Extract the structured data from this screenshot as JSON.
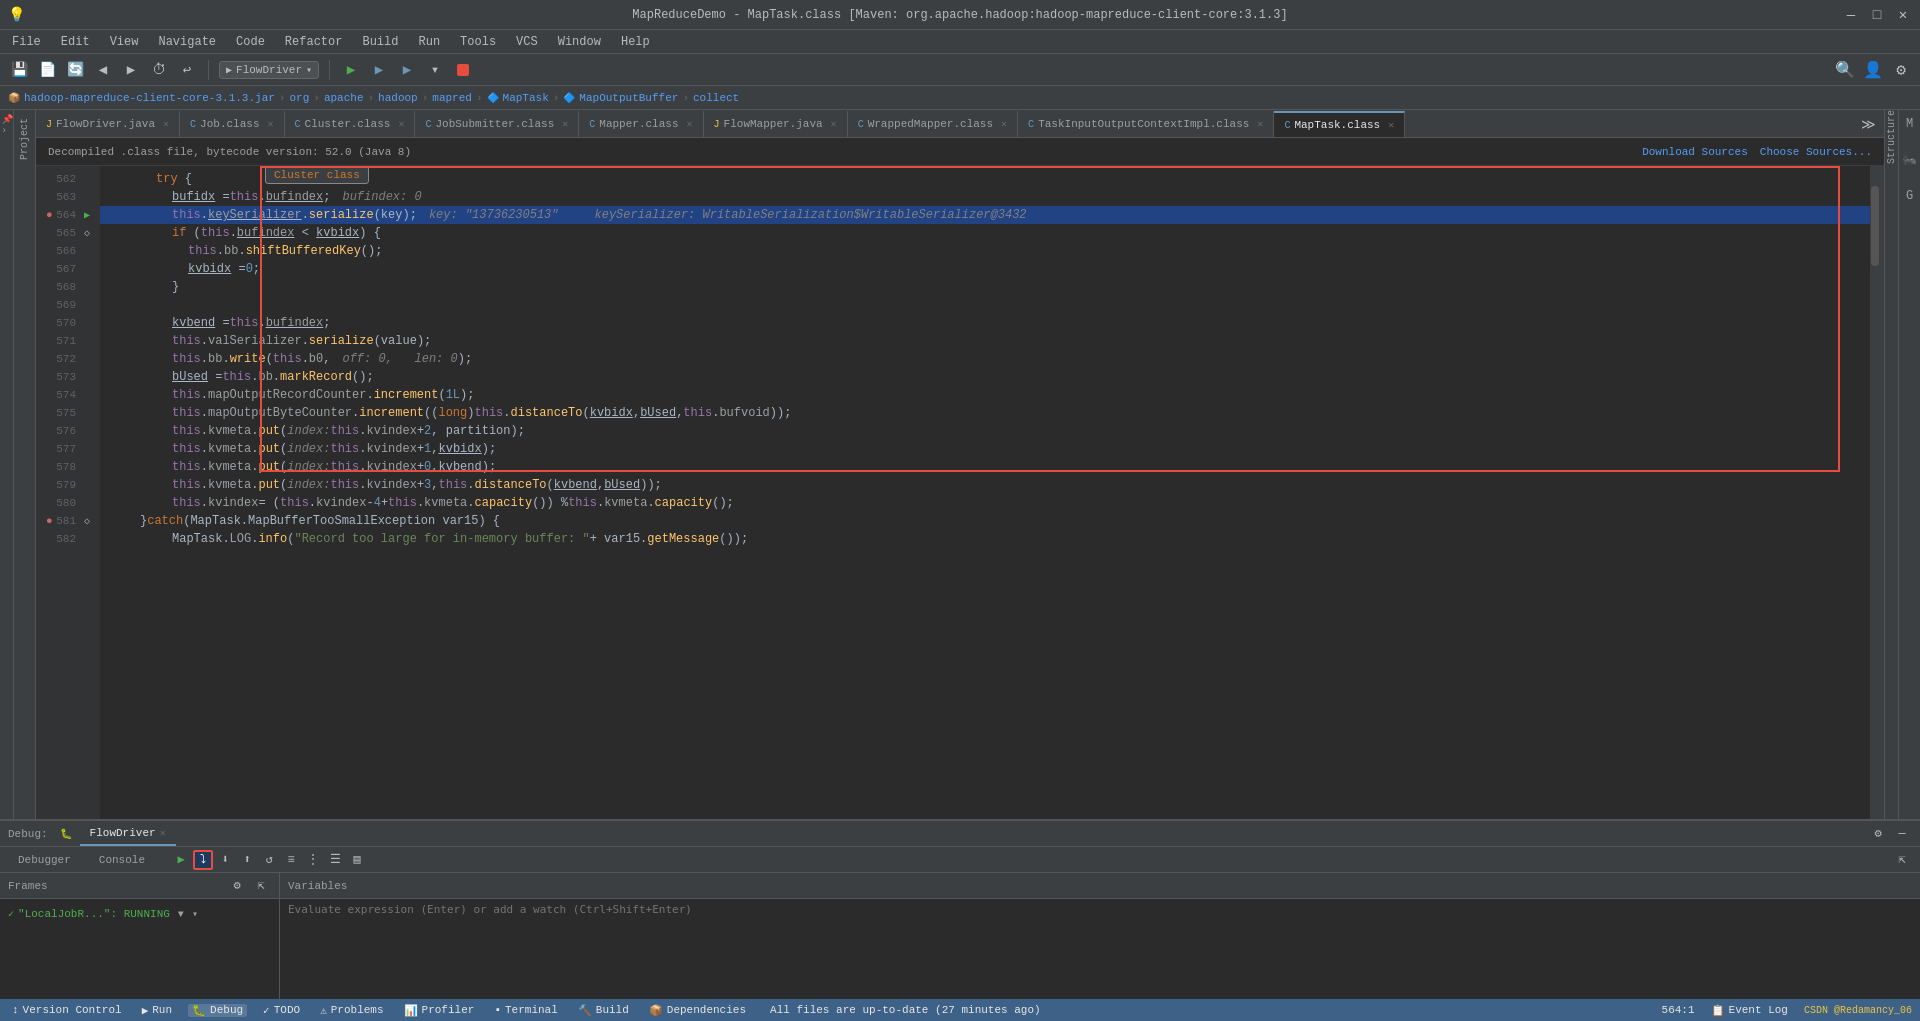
{
  "titleBar": {
    "title": "MapReduceDemo - MapTask.class [Maven: org.apache.hadoop:hadoop-mapreduce-client-core:3.1.3]",
    "minimize": "—",
    "maximize": "□",
    "close": "✕"
  },
  "menuBar": {
    "items": [
      "File",
      "Edit",
      "View",
      "Navigate",
      "Code",
      "Refactor",
      "Build",
      "Run",
      "Tools",
      "VCS",
      "Window",
      "Help"
    ]
  },
  "breadcrumb": {
    "items": [
      "hadoop-mapreduce-client-core-3.1.3.jar",
      "org",
      "apache",
      "hadoop",
      "mapred",
      "MapTask",
      "MapOutputBuffer",
      "collect"
    ]
  },
  "tabs": [
    {
      "label": "FlowDriver.java",
      "icon": "J",
      "active": false
    },
    {
      "label": "Job.class",
      "icon": "C",
      "active": false
    },
    {
      "label": "Cluster.class",
      "icon": "C",
      "active": false
    },
    {
      "label": "JobSubmitter.class",
      "icon": "C",
      "active": false
    },
    {
      "label": "Mapper.class",
      "icon": "C",
      "active": false
    },
    {
      "label": "FlowMapper.java",
      "icon": "J",
      "active": false
    },
    {
      "label": "WrappedMapper.class",
      "icon": "C",
      "active": false
    },
    {
      "label": "TaskInputOutputContextImpl.class",
      "icon": "C",
      "active": false
    },
    {
      "label": "MapTask.class",
      "icon": "C",
      "active": true
    }
  ],
  "infoBar": {
    "message": "Decompiled .class file, bytecode version: 52.0 (Java 8)",
    "downloadSources": "Download Sources",
    "chooseSources": "Choose Sources..."
  },
  "clusterClass": "Cluster class",
  "codeLines": [
    {
      "num": "562",
      "content": "try {",
      "indent": 6,
      "highlight": false,
      "breakpoint": false
    },
    {
      "num": "563",
      "content": "bufidx = this.bufindex;",
      "indent": 8,
      "highlight": false,
      "breakpoint": false,
      "inlineVal": "bufindex: 0"
    },
    {
      "num": "564",
      "content": "this.keySerializer.serialize(key);",
      "indent": 8,
      "highlight": true,
      "breakpoint": true,
      "inlineVal": "key: \"13736230513\"    keySerializer: WritableSerialization$WritableSerializer@3432"
    },
    {
      "num": "565",
      "content": "if (this.bufindex < kvbidx) {",
      "indent": 8,
      "highlight": false,
      "breakpoint": false
    },
    {
      "num": "566",
      "content": "this.bb.shiftBufferedKey();",
      "indent": 10,
      "highlight": false,
      "breakpoint": false
    },
    {
      "num": "567",
      "content": "kvbidx = 0;",
      "indent": 10,
      "highlight": false,
      "breakpoint": false
    },
    {
      "num": "568",
      "content": "}",
      "indent": 8,
      "highlight": false,
      "breakpoint": false
    },
    {
      "num": "569",
      "content": "",
      "indent": 0,
      "highlight": false,
      "breakpoint": false
    },
    {
      "num": "570",
      "content": "kvbend = this.bufindex;",
      "indent": 8,
      "highlight": false,
      "breakpoint": false
    },
    {
      "num": "571",
      "content": "this.valSerializer.serialize(value);",
      "indent": 8,
      "highlight": false,
      "breakpoint": false
    },
    {
      "num": "572",
      "content": "this.bb.write(this.b0,",
      "indent": 8,
      "highlight": false,
      "breakpoint": false,
      "inlineVal": "off: 0,   len: 0"
    },
    {
      "num": "573",
      "content": "bUsed = this.bb.markRecord();",
      "indent": 8,
      "highlight": false,
      "breakpoint": false
    },
    {
      "num": "574",
      "content": "this.mapOutputRecordCounter.increment(1L);",
      "indent": 8,
      "highlight": false,
      "breakpoint": false
    },
    {
      "num": "575",
      "content": "this.mapOutputByteCounter.increment((long)this.distanceTo(kvbidx, bUsed, this.bufvoid));",
      "indent": 8,
      "highlight": false,
      "breakpoint": false
    },
    {
      "num": "576",
      "content": "this.kvmeta.put( index: this.kvindex + 2, partition);",
      "indent": 8,
      "highlight": false,
      "breakpoint": false
    },
    {
      "num": "577",
      "content": "this.kvmeta.put( index: this.kvindex + 1, kvbidx);",
      "indent": 8,
      "highlight": false,
      "breakpoint": false
    },
    {
      "num": "578",
      "content": "this.kvmeta.put( index: this.kvindex + 0, kvbend);",
      "indent": 8,
      "highlight": false,
      "breakpoint": false
    },
    {
      "num": "579",
      "content": "this.kvmeta.put( index: this.kvindex + 3, this.distanceTo(kvbend, bUsed));",
      "indent": 8,
      "highlight": false,
      "breakpoint": false
    },
    {
      "num": "580",
      "content": "this.kvindex = (this.kvindex - 4 + this.kvmeta.capacity()) % this.kvmeta.capacity();",
      "indent": 8,
      "highlight": false,
      "breakpoint": false
    },
    {
      "num": "581",
      "content": "} catch (MapTask.MapBufferTooSmallException var15) {",
      "indent": 6,
      "highlight": false,
      "breakpoint": true
    },
    {
      "num": "582",
      "content": "MapTask.LOG.info(\"Record too large for in-memory buffer: \" + var15.getMessage());",
      "indent": 8,
      "highlight": false,
      "breakpoint": false
    }
  ],
  "debugPanel": {
    "title": "Debug:",
    "sessionName": "FlowDriver",
    "tabs": [
      {
        "label": "Debugger",
        "active": false
      },
      {
        "label": "Console",
        "active": false
      }
    ],
    "toolbar": {
      "buttons": [
        "▲",
        "▼",
        "⇥",
        "↩",
        "⬆",
        "↺",
        "⋮",
        "☰",
        "≡"
      ]
    },
    "frames": {
      "header": "Frames",
      "items": [
        {
          "label": "\"LocalJobR...\": RUNNING"
        }
      ]
    },
    "variables": {
      "header": "Variables",
      "evalPlaceholder": "Evaluate expression (Enter) or add a watch (Ctrl+Shift+Enter)"
    }
  },
  "statusBar": {
    "tabs": [
      {
        "label": "Version Control",
        "icon": "↕"
      },
      {
        "label": "Run",
        "icon": "▶"
      },
      {
        "label": "Debug",
        "icon": "🐛"
      },
      {
        "label": "TODO",
        "icon": "✓"
      },
      {
        "label": "Problems",
        "icon": "⚠"
      },
      {
        "label": "Profiler",
        "icon": "📊"
      },
      {
        "label": "Terminal",
        "icon": "▪"
      },
      {
        "label": "Build",
        "icon": "🔨"
      },
      {
        "label": "Dependencies",
        "icon": "📦"
      }
    ],
    "position": "564:1",
    "eventLog": "Event Log",
    "message": "All files are up-to-date (27 minutes ago)",
    "csdn": "CSDN @Redamancy_06"
  }
}
